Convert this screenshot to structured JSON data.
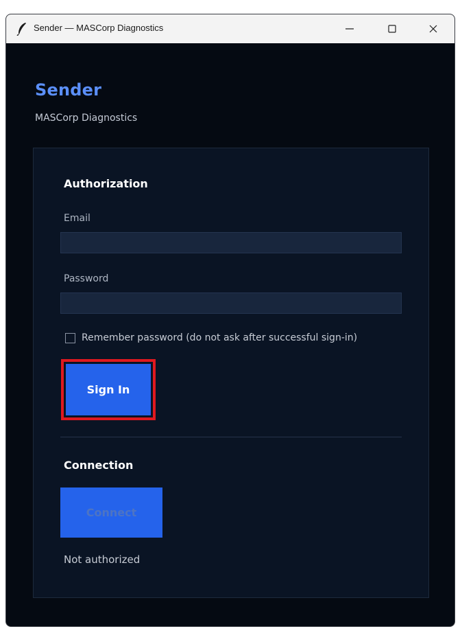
{
  "window": {
    "title": "Sender — MASCorp Diagnostics",
    "controls": {
      "minimize_icon": "minimize-icon",
      "maximize_icon": "maximize-icon",
      "close_icon": "close-icon"
    }
  },
  "header": {
    "title": "Sender",
    "subtitle": "MASCorp Diagnostics"
  },
  "auth": {
    "section_title": "Authorization",
    "email_label": "Email",
    "email_value": "",
    "password_label": "Password",
    "password_value": "",
    "remember_label": "Remember password (do not ask after successful sign-in)",
    "remember_checked": false,
    "signin_label": "Sign In"
  },
  "connection": {
    "section_title": "Connection",
    "connect_label": "Connect",
    "connect_enabled": false,
    "status": "Not authorized"
  },
  "colors": {
    "accent": "#2563eb",
    "title_blue": "#5b8ff9",
    "background": "#050a12",
    "panel": "#0a1424",
    "highlight": "#e0191f"
  }
}
